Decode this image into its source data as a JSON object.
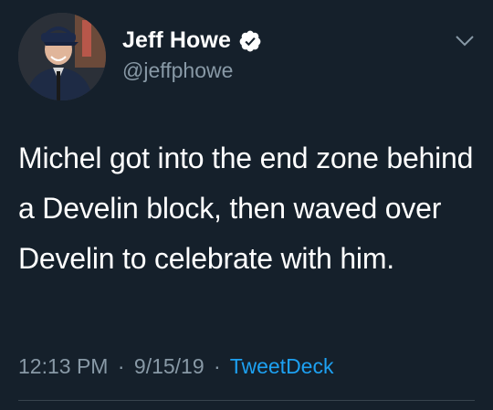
{
  "author": {
    "name": "Jeff Howe",
    "handle": "@jeffphowe",
    "verified": true,
    "avatar_icon": "profile-photo"
  },
  "tweet": {
    "text": "Michel got into the end zone behind a Develin block, then waved over Develin to celebrate with him.",
    "time": "12:13 PM",
    "date": "9/15/19",
    "separator": "·",
    "source": "TweetDeck"
  },
  "colors": {
    "background": "#15202b",
    "secondary_text": "#8899a6",
    "link": "#1da1f2",
    "verified_badge": "#ffffff"
  },
  "icons": {
    "verified": "verified-badge-icon",
    "menu": "chevron-down-icon"
  }
}
